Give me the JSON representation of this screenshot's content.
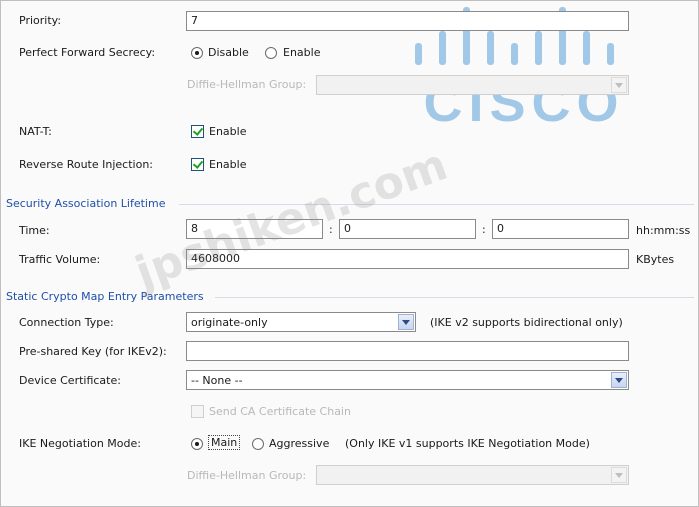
{
  "priority": {
    "label": "Priority:",
    "value": "7"
  },
  "pfs": {
    "label": "Perfect Forward Secrecy:",
    "disable_label": "Disable",
    "enable_label": "Enable",
    "selected": "Disable"
  },
  "dh_group_1": {
    "label": "Diffie-Hellman Group:",
    "value": ""
  },
  "nat_t": {
    "label": "NAT-T:",
    "checkbox_label": "Enable",
    "checked": true
  },
  "rri": {
    "label": "Reverse Route Injection:",
    "checkbox_label": "Enable",
    "checked": true
  },
  "sa_lifetime": {
    "title": "Security Association Lifetime",
    "time_label": "Time:",
    "hours": "8",
    "minutes": "0",
    "seconds": "0",
    "sep1": ":",
    "sep2": ":",
    "time_unit": "hh:mm:ss",
    "traffic_label": "Traffic Volume:",
    "traffic_value": "4608000",
    "traffic_unit": "KBytes"
  },
  "crypto_map": {
    "title": "Static Crypto Map Entry Parameters",
    "connection_type_label": "Connection Type:",
    "connection_type_value": "originate-only",
    "connection_type_note": "(IKE v2 supports bidirectional only)",
    "psk_label": "Pre-shared Key (for IKEv2):",
    "psk_value": "",
    "device_cert_label": "Device Certificate:",
    "device_cert_value": "-- None --",
    "send_ca_label": "Send CA Certificate Chain",
    "ike_mode_label": "IKE Negotiation Mode:",
    "ike_main_label": "Main",
    "ike_aggressive_label": "Aggressive",
    "ike_mode_selected": "Main",
    "ike_mode_note": "(Only IKE v1 supports IKE Negotiation Mode)",
    "dh_group_label": "Diffie-Hellman Group:",
    "dh_group_value": ""
  },
  "branding": {
    "logo_text": "CISCO",
    "logo_color": "#5aa0d8",
    "watermark_text": "jpshiken.com"
  },
  "colors": {
    "section_title": "#1f4fa8",
    "check_mark": "#21a121"
  }
}
